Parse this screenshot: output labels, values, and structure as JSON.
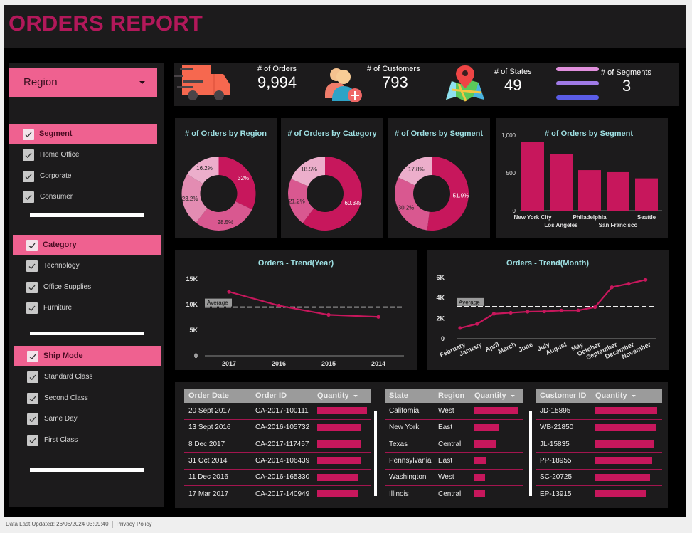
{
  "title": "ORDERS REPORT",
  "colors": {
    "accent": "#c7175c",
    "pink": "#ef6190",
    "title": "#b2185a",
    "panel": "#1c1b1c",
    "chart_title": "#9ee0e3",
    "donut": [
      "#c7175c",
      "#d95890",
      "#e38cb2",
      "#ecaecb"
    ]
  },
  "sidebar": {
    "region_dropdown": {
      "label": "Region",
      "icon": "caret-down-icon"
    },
    "groups": [
      {
        "title": "Segment",
        "items": [
          "Home Office",
          "Corporate",
          "Consumer"
        ]
      },
      {
        "title": "Category",
        "items": [
          "Technology",
          "Office Supplies",
          "Furniture"
        ]
      },
      {
        "title": "Ship Mode",
        "items": [
          "Standard Class",
          "Second Class",
          "Same Day",
          "First Class"
        ]
      }
    ]
  },
  "kpis": [
    {
      "label": "# of Orders",
      "value": "9,994",
      "icon": "delivery-truck-icon"
    },
    {
      "label": "# of Customers",
      "value": "793",
      "icon": "add-users-icon"
    },
    {
      "label": "# of States",
      "value": "49",
      "icon": "map-pin-icon"
    },
    {
      "label": "# of Segments",
      "value": "3",
      "icon": "segments-lines-icon"
    }
  ],
  "chart_data": [
    {
      "type": "pie",
      "title": "# of Orders by Region",
      "slices": [
        {
          "label": "32%",
          "value": 32.0
        },
        {
          "label": "28.5%",
          "value": 28.5
        },
        {
          "label": "23.2%",
          "value": 23.2
        },
        {
          "label": "16.2%",
          "value": 16.2
        }
      ]
    },
    {
      "type": "pie",
      "title": "# of Orders by Category",
      "slices": [
        {
          "label": "60.3%",
          "value": 60.3
        },
        {
          "label": "21.2%",
          "value": 21.2
        },
        {
          "label": "18.5%",
          "value": 18.5
        }
      ]
    },
    {
      "type": "pie",
      "title": "# of Orders by Segment",
      "slices": [
        {
          "label": "51.9%",
          "value": 51.9
        },
        {
          "label": "30.2%",
          "value": 30.2
        },
        {
          "label": "17.8%",
          "value": 17.8
        }
      ]
    },
    {
      "type": "bar",
      "title": "# of Orders by Segment",
      "categories": [
        "New York City",
        "Los Angeles",
        "Philadelphia",
        "San Francisco",
        "Seattle"
      ],
      "values": [
        915,
        747,
        537,
        510,
        428
      ],
      "ylim": [
        0,
        1000
      ],
      "yticks": [
        "0",
        "500",
        "1,000"
      ]
    },
    {
      "type": "line",
      "title": "Orders - Trend(Year)",
      "categories": [
        "2017",
        "2016",
        "2015",
        "2014"
      ],
      "values": [
        12500,
        9800,
        8000,
        7600
      ],
      "ylim": [
        0,
        15000
      ],
      "yticks": [
        "0",
        "5K",
        "10K",
        "15K"
      ],
      "average": 9500,
      "average_label": "Average"
    },
    {
      "type": "line",
      "title": "Orders - Trend(Month)",
      "categories": [
        "February",
        "January",
        "April",
        "March",
        "June",
        "July",
        "August",
        "May",
        "October",
        "September",
        "December",
        "November"
      ],
      "values": [
        1050,
        1450,
        2450,
        2550,
        2650,
        2680,
        2770,
        2780,
        3100,
        5050,
        5400,
        5780
      ],
      "ylim": [
        0,
        6000
      ],
      "yticks": [
        "0",
        "2K",
        "4K",
        "6K"
      ],
      "average": 3150,
      "average_label": "Average"
    }
  ],
  "tables": {
    "orders": {
      "headers": [
        "Order Date",
        "Order ID",
        "Quantity"
      ],
      "rows": [
        {
          "date": "20 Sept 2017",
          "id": "CA-2017-100111",
          "qty_frac": 1.0
        },
        {
          "date": "13 Sept 2016",
          "id": "CA-2016-105732",
          "qty_frac": 0.89
        },
        {
          "date": "8 Dec 2017",
          "id": "CA-2017-117457",
          "qty_frac": 0.89
        },
        {
          "date": "31 Oct 2014",
          "id": "CA-2014-106439",
          "qty_frac": 0.87
        },
        {
          "date": "11 Dec 2016",
          "id": "CA-2016-165330",
          "qty_frac": 0.83
        },
        {
          "date": "17 Mar 2017",
          "id": "CA-2017-140949",
          "qty_frac": 0.83
        }
      ]
    },
    "states": {
      "headers": [
        "State",
        "Region",
        "Quantity"
      ],
      "rows": [
        {
          "state": "California",
          "region": "West",
          "qty_frac": 1.0
        },
        {
          "state": "New York",
          "region": "East",
          "qty_frac": 0.56
        },
        {
          "state": "Texas",
          "region": "Central",
          "qty_frac": 0.49
        },
        {
          "state": "Pennsylvania",
          "region": "East",
          "qty_frac": 0.28
        },
        {
          "state": "Washington",
          "region": "West",
          "qty_frac": 0.25
        },
        {
          "state": "Illinois",
          "region": "Central",
          "qty_frac": 0.25
        }
      ]
    },
    "customers": {
      "headers": [
        "Customer ID",
        "Quantity"
      ],
      "rows": [
        {
          "id": "JD-15895",
          "qty_frac": 1.0
        },
        {
          "id": "WB-21850",
          "qty_frac": 0.98
        },
        {
          "id": "JL-15835",
          "qty_frac": 0.95
        },
        {
          "id": "PP-18955",
          "qty_frac": 0.92
        },
        {
          "id": "SC-20725",
          "qty_frac": 0.88
        },
        {
          "id": "EP-13915",
          "qty_frac": 0.83
        }
      ]
    }
  },
  "footer": {
    "updated": "Data Last Updated: 26/06/2024 03:09:40",
    "privacy": "Privacy Policy"
  }
}
